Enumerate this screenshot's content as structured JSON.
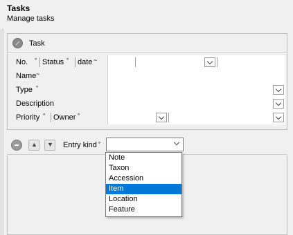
{
  "header": {
    "title": "Tasks",
    "subtitle": "Manage tasks"
  },
  "panel": {
    "label": "Task"
  },
  "form": {
    "row1": {
      "no": "No.",
      "status": "Status",
      "date": "date"
    },
    "name": "Name",
    "type": "Type",
    "description": "Description",
    "priority": "Priority",
    "owner": "Owner"
  },
  "toolbar": {
    "entry_kind_label": "Entry kind",
    "entry_kind_value": ""
  },
  "dropdown": {
    "options": [
      "Note",
      "Taxon",
      "Accession",
      "Item",
      "Location",
      "Feature"
    ],
    "selected": "Item"
  },
  "colors": {
    "selection": "#0078d7"
  }
}
